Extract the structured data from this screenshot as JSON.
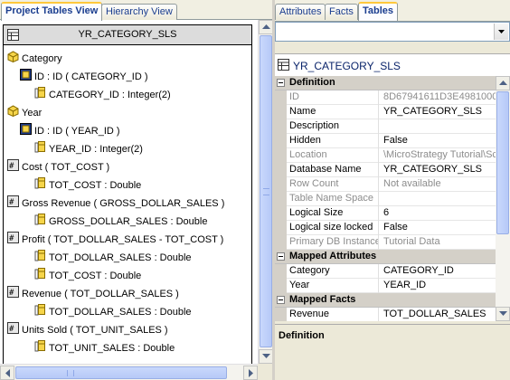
{
  "left_panel": {
    "tabs": [
      {
        "label": "Project Tables View"
      },
      {
        "label": "Hierarchy View"
      }
    ],
    "table": {
      "name": "YR_CATEGORY_SLS",
      "rows": [
        {
          "text": "Category",
          "icon": "attribute-icon",
          "indent": 0
        },
        {
          "text": "ID : ID ( CATEGORY_ID )",
          "icon": "attribute-form-icon",
          "indent": 1
        },
        {
          "text": "CATEGORY_ID : Integer(2)",
          "icon": "column-icon",
          "indent": 2
        },
        {
          "text": "Year",
          "icon": "attribute-icon",
          "indent": 0
        },
        {
          "text": "ID : ID ( YEAR_ID )",
          "icon": "attribute-form-icon",
          "indent": 1
        },
        {
          "text": "YEAR_ID : Integer(2)",
          "icon": "column-icon",
          "indent": 2
        },
        {
          "text": "Cost ( TOT_COST )",
          "icon": "fact-icon",
          "indent": 0
        },
        {
          "text": "TOT_COST : Double",
          "icon": "column-icon",
          "indent": 2
        },
        {
          "text": "Gross Revenue ( GROSS_DOLLAR_SALES )",
          "icon": "fact-icon",
          "indent": 0
        },
        {
          "text": "GROSS_DOLLAR_SALES : Double",
          "icon": "column-icon",
          "indent": 2
        },
        {
          "text": "Profit ( TOT_DOLLAR_SALES - TOT_COST )",
          "icon": "fact-icon",
          "indent": 0
        },
        {
          "text": "TOT_DOLLAR_SALES : Double",
          "icon": "column-icon",
          "indent": 2
        },
        {
          "text": "TOT_COST : Double",
          "icon": "column-icon",
          "indent": 2
        },
        {
          "text": "Revenue ( TOT_DOLLAR_SALES )",
          "icon": "fact-icon",
          "indent": 0
        },
        {
          "text": "TOT_DOLLAR_SALES : Double",
          "icon": "column-icon",
          "indent": 2
        },
        {
          "text": "Units Sold ( TOT_UNIT_SALES )",
          "icon": "fact-icon",
          "indent": 0
        },
        {
          "text": "TOT_UNIT_SALES : Double",
          "icon": "column-icon",
          "indent": 2
        }
      ]
    }
  },
  "right_panel": {
    "tabs": [
      {
        "label": "Attributes"
      },
      {
        "label": "Facts"
      },
      {
        "label": "Tables"
      }
    ],
    "combo_value": "",
    "object_title": "YR_CATEGORY_SLS",
    "properties": [
      {
        "category": "Definition"
      },
      {
        "name": "ID",
        "value": "8D67941611D3E4981000",
        "dim": true
      },
      {
        "name": "Name",
        "value": "YR_CATEGORY_SLS",
        "dim": false
      },
      {
        "name": "Description",
        "value": "",
        "dim": false
      },
      {
        "name": "Hidden",
        "value": "False",
        "dim": false
      },
      {
        "name": "Location",
        "value": "\\MicroStrategy Tutorial\\Sc",
        "dim": true
      },
      {
        "name": "Database Name",
        "value": "YR_CATEGORY_SLS",
        "dim": false
      },
      {
        "name": "Row Count",
        "value": "Not available",
        "dim": true
      },
      {
        "name": "Table Name Space",
        "value": "",
        "dim": true
      },
      {
        "name": "Logical Size",
        "value": "6",
        "dim": false
      },
      {
        "name": "Logical size locked",
        "value": "False",
        "dim": false
      },
      {
        "name": "Primary DB Instance",
        "value": "Tutorial Data",
        "dim": true
      },
      {
        "category": "Mapped Attributes"
      },
      {
        "name": "Category",
        "value": "CATEGORY_ID",
        "dim": false
      },
      {
        "name": "Year",
        "value": "YEAR_ID",
        "dim": false
      },
      {
        "category": "Mapped Facts"
      },
      {
        "name": "Revenue",
        "value": "TOT_DOLLAR_SALES",
        "dim": false
      }
    ],
    "description_title": "Definition"
  }
}
